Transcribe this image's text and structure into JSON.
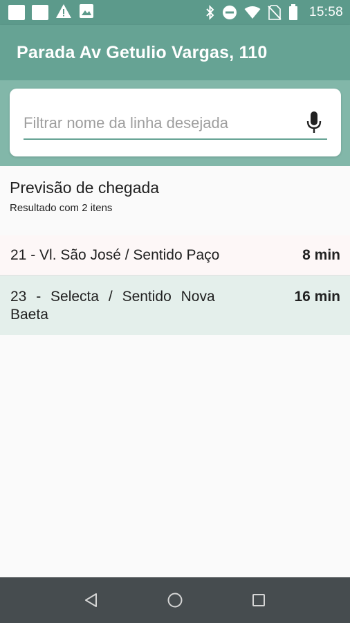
{
  "status_bar": {
    "time": "15:58",
    "icons": [
      "notification-square-icon",
      "notification-square-icon",
      "warning-icon",
      "image-icon",
      "bluetooth-icon",
      "do-not-disturb-icon",
      "wifi-icon",
      "no-sim-icon",
      "battery-icon"
    ]
  },
  "app_bar": {
    "title": "Parada Av Getulio Vargas, 110"
  },
  "search": {
    "placeholder": "Filtrar nome da linha desejada",
    "value": "",
    "mic_icon": "mic-icon"
  },
  "results": {
    "title": "Previsão de chegada",
    "subtitle": "Resultado com 2 itens",
    "items": [
      {
        "line": "21 - Vl. São José / Sentido Paço",
        "eta": "8 min"
      },
      {
        "line": "23 - Selecta / Sentido Nova Baeta",
        "eta": "16 min"
      }
    ]
  },
  "nav_bar": {
    "buttons": [
      "back-icon",
      "home-icon",
      "recents-icon"
    ]
  },
  "colors": {
    "primary": "#66a394",
    "status_bar": "#5c9a8b",
    "search_band": "#82b7a9",
    "row_highlight": "#e4efeb",
    "nav_bar": "#464c4f"
  }
}
